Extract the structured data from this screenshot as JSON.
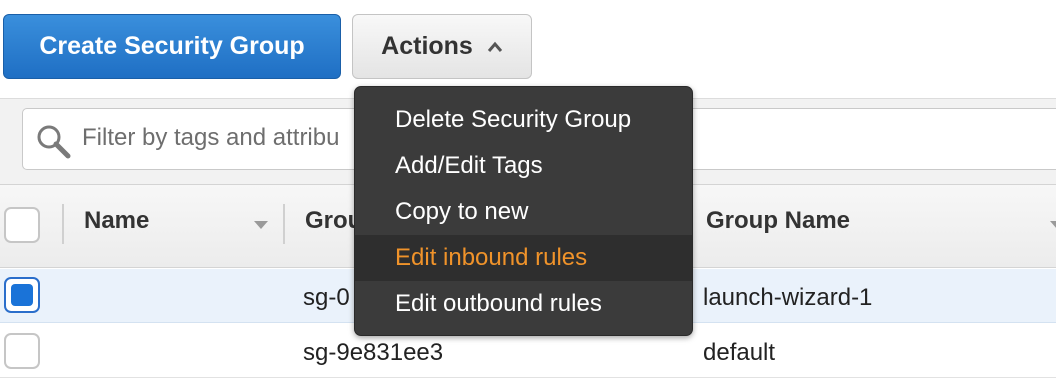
{
  "toolbar": {
    "create_label": "Create Security Group",
    "actions_label": "Actions"
  },
  "filter": {
    "placeholder": "Filter by tags and attributes or search by keyword",
    "visible_text": "Filter by tags and attribu"
  },
  "table": {
    "headers": [
      "Name",
      "Group",
      "Group Name"
    ],
    "header_visible": [
      "Name",
      "Grou",
      "Group Name"
    ],
    "rows": [
      {
        "selected": true,
        "name": "",
        "group_id": "sg-0",
        "group_name": "launch-wizard-1"
      },
      {
        "selected": false,
        "name": "",
        "group_id": "sg-9e831ee3",
        "group_name": "default"
      }
    ]
  },
  "actions_menu": {
    "items": [
      {
        "label": "Delete Security Group",
        "active": false
      },
      {
        "label": "Add/Edit Tags",
        "active": false
      },
      {
        "label": "Copy to new",
        "active": false
      },
      {
        "label": "Edit inbound rules",
        "active": true
      },
      {
        "label": "Edit outbound rules",
        "active": false
      }
    ]
  },
  "colors": {
    "primary": "#1f6fc4",
    "menu_bg": "#3b3b3b",
    "menu_highlight": "#f0932a",
    "selected_row": "#eaf2fb"
  },
  "icons": {
    "search": "search-icon",
    "caret": "chevron-up-icon",
    "sort": "sort-down-icon"
  }
}
